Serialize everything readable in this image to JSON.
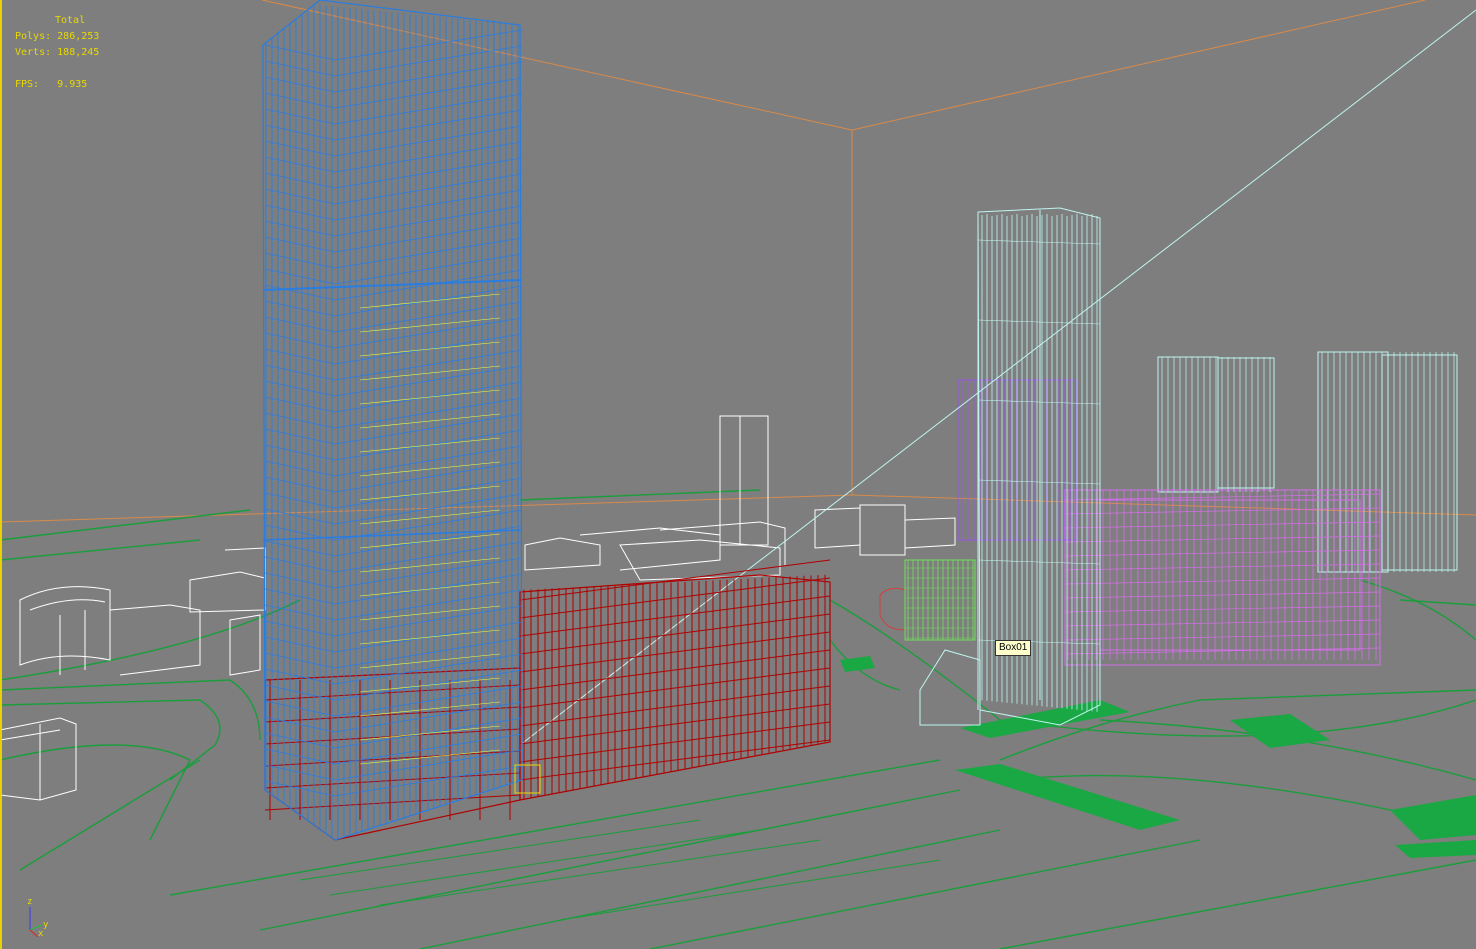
{
  "stats": {
    "title": "Total",
    "polys_label": "Polys:",
    "polys_value": "286,253",
    "verts_label": "Verts:",
    "verts_value": "188,245",
    "fps_label": "FPS:",
    "fps_value": "9.935"
  },
  "selection_tooltip": "Box01",
  "axis_gizmo": {
    "z": "z",
    "y": "y",
    "x": "x"
  },
  "colors": {
    "background": "#7e7e7e",
    "stats_text": "#e8d800",
    "tower_blue": "#2a7de0",
    "podium_red": "#b00000",
    "magenta": "#d36ee6",
    "cyan": "#bff5f0",
    "ground_green": "#1a9e3c",
    "bounding_orange": "#d88a4a",
    "white_context": "#ffffff",
    "purple": "#9a55e8",
    "green_block": "#6ee05a"
  }
}
